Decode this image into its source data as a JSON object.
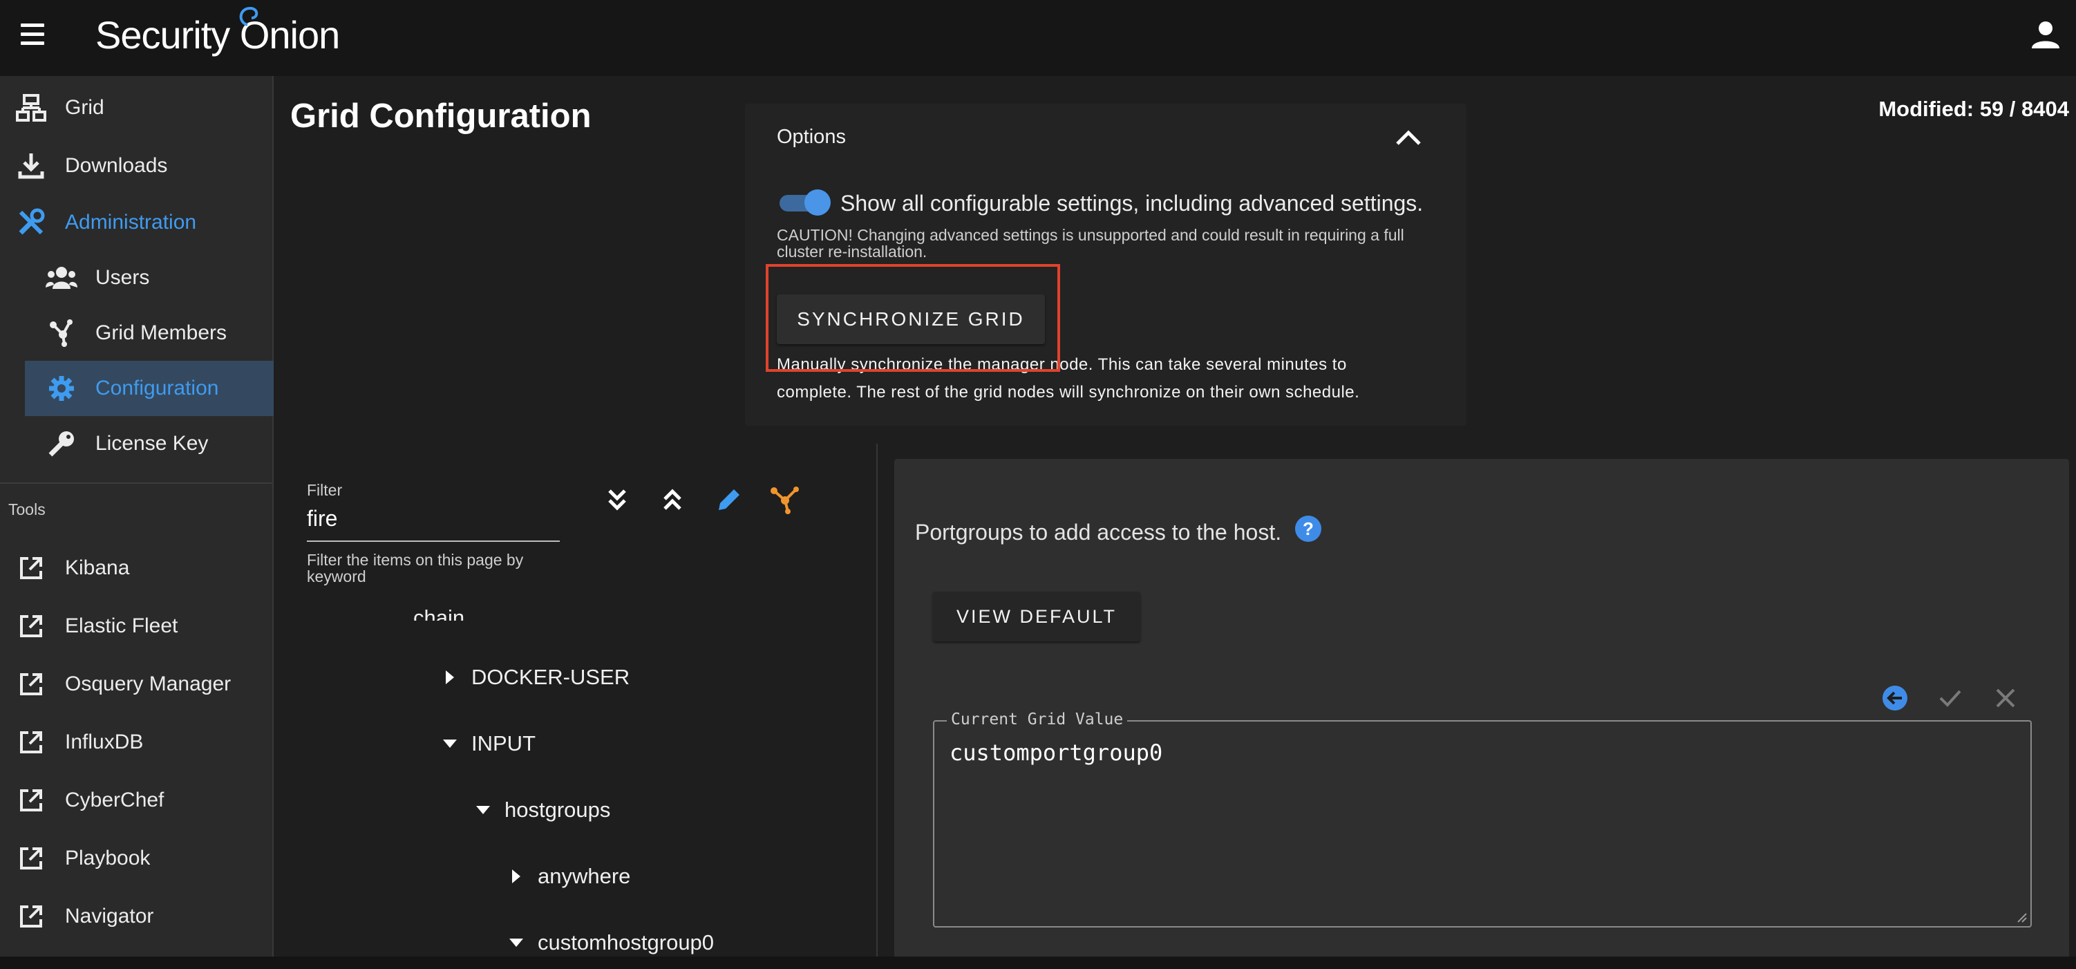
{
  "app": {
    "brand": "Security Onion"
  },
  "sidebar": {
    "items": [
      {
        "label": "Grid",
        "icon": "grid-network-icon"
      },
      {
        "label": "Downloads",
        "icon": "download-icon"
      },
      {
        "label": "Administration",
        "icon": "tools-icon"
      }
    ],
    "sub_items": [
      {
        "label": "Users",
        "icon": "users-icon"
      },
      {
        "label": "Grid Members",
        "icon": "grid-members-icon"
      },
      {
        "label": "Configuration",
        "icon": "gear-icon"
      },
      {
        "label": "License Key",
        "icon": "key-icon"
      }
    ],
    "tools_label": "Tools",
    "tools": [
      {
        "label": "Kibana",
        "icon": "external-link-icon"
      },
      {
        "label": "Elastic Fleet",
        "icon": "external-link-icon"
      },
      {
        "label": "Osquery Manager",
        "icon": "external-link-icon"
      },
      {
        "label": "InfluxDB",
        "icon": "external-link-icon"
      },
      {
        "label": "CyberChef",
        "icon": "external-link-icon"
      },
      {
        "label": "Playbook",
        "icon": "external-link-icon"
      },
      {
        "label": "Navigator",
        "icon": "external-link-icon"
      }
    ]
  },
  "main": {
    "title": "Grid Configuration",
    "modified": "Modified: 59 / 8404"
  },
  "options": {
    "title": "Options",
    "toggle_label": "Show all configurable settings, including advanced settings.",
    "toggle_on": true,
    "caution": "CAUTION! Changing advanced settings is unsupported and could result in requiring a full cluster re-installation.",
    "sync_button": "SYNCHRONIZE GRID",
    "sync_desc": "Manually synchronize the manager node. This can take several minutes to complete. The rest of the grid nodes will synchronize on their own schedule."
  },
  "filter": {
    "label": "Filter",
    "value": "fire",
    "hint": "Filter the items on this page by keyword"
  },
  "tree": {
    "partial_label": "chain",
    "items": [
      {
        "label": "DOCKER-USER",
        "expanded": false
      },
      {
        "label": "INPUT",
        "expanded": true
      },
      {
        "label": "hostgroups",
        "expanded": true
      },
      {
        "label": "anywhere",
        "expanded": false
      },
      {
        "label": "customhostgroup0",
        "expanded": true
      }
    ]
  },
  "detail": {
    "description": "Portgroups to add access to the host.",
    "help": "?",
    "view_default_button": "VIEW DEFAULT",
    "current_value_label": "Current Grid Value",
    "current_value": "customportgroup0"
  },
  "colors": {
    "accent": "#3f9bf0",
    "highlight": "#e0432c",
    "orange": "#f0952e"
  }
}
